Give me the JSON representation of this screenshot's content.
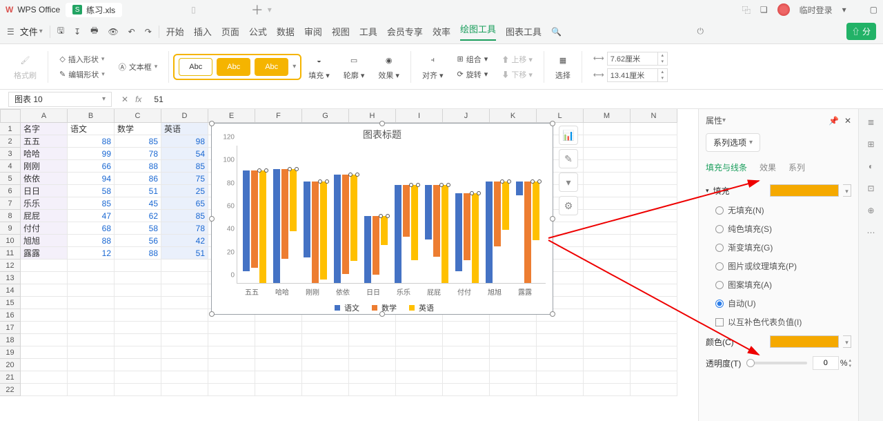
{
  "app": {
    "name": "WPS Office",
    "doc": "练习.xls",
    "user": "临时登录"
  },
  "menus": {
    "file": "文件",
    "items": [
      "开始",
      "插入",
      "页面",
      "公式",
      "数据",
      "审阅",
      "视图",
      "工具",
      "会员专享",
      "效率",
      "绘图工具",
      "图表工具"
    ],
    "active": "绘图工具",
    "share": "分"
  },
  "ribbon": {
    "format_painter": "格式刷",
    "insert_shape": "插入形状",
    "edit_shape": "编辑形状",
    "text_box": "文本框",
    "abc": "Abc",
    "fill": "填充",
    "outline": "轮廓",
    "effect": "效果",
    "align": "对齐",
    "group": "组合",
    "rotate": "旋转",
    "up": "上移",
    "down": "下移",
    "select": "选择",
    "width": "7.62厘米",
    "height": "13.41厘米"
  },
  "fbar": {
    "name": "图表 10",
    "value": "51"
  },
  "cols": [
    "A",
    "B",
    "C",
    "D",
    "E",
    "F",
    "G",
    "H",
    "I",
    "J",
    "K",
    "L",
    "M",
    "N"
  ],
  "sheet": {
    "hdr": [
      "名字",
      "语文",
      "数学",
      "英语"
    ],
    "rows": [
      [
        "五五",
        88,
        85,
        98
      ],
      [
        "哈哈",
        99,
        78,
        54
      ],
      [
        "刚刚",
        66,
        88,
        85
      ],
      [
        "依依",
        94,
        86,
        75
      ],
      [
        "日日",
        58,
        51,
        25
      ],
      [
        "乐乐",
        85,
        45,
        65
      ],
      [
        "屁屁",
        47,
        62,
        85
      ],
      [
        "付付",
        68,
        58,
        78
      ],
      [
        "旭旭",
        88,
        56,
        42
      ],
      [
        "露露",
        12,
        88,
        51
      ]
    ]
  },
  "chart_data": {
    "type": "bar",
    "title": "图表标题",
    "categories": [
      "五五",
      "哈哈",
      "刚刚",
      "依依",
      "日日",
      "乐乐",
      "屁屁",
      "付付",
      "旭旭",
      "露露"
    ],
    "series": [
      {
        "name": "语文",
        "color": "#4472c4",
        "values": [
          88,
          99,
          66,
          94,
          58,
          85,
          47,
          68,
          88,
          12
        ]
      },
      {
        "name": "数学",
        "color": "#ed7d31",
        "values": [
          85,
          78,
          88,
          86,
          51,
          45,
          62,
          58,
          56,
          88
        ]
      },
      {
        "name": "英语",
        "color": "#ffc000",
        "values": [
          98,
          54,
          85,
          75,
          25,
          65,
          85,
          78,
          42,
          51
        ]
      }
    ],
    "ylim": [
      0,
      120
    ],
    "yticks": [
      0,
      20,
      40,
      60,
      80,
      100,
      120
    ],
    "xlabel": "",
    "ylabel": ""
  },
  "rpanel": {
    "title": "属性",
    "series_options": "系列选项",
    "tabs": {
      "fill_line": "填充与线条",
      "effect": "效果",
      "series": "系列"
    },
    "fill_section": "填充",
    "fill_opts": {
      "none": "无填充(N)",
      "solid": "纯色填充(S)",
      "gradient": "渐变填充(G)",
      "picture": "图片或纹理填充(P)",
      "pattern": "图案填充(A)",
      "auto": "自动(U)"
    },
    "invert_neg": "以互补色代表负值(I)",
    "color_label": "颜色(C)",
    "opacity_label": "透明度(T)",
    "opacity_val": "0",
    "pct": "%",
    "swatch_color": "#f5a900"
  }
}
